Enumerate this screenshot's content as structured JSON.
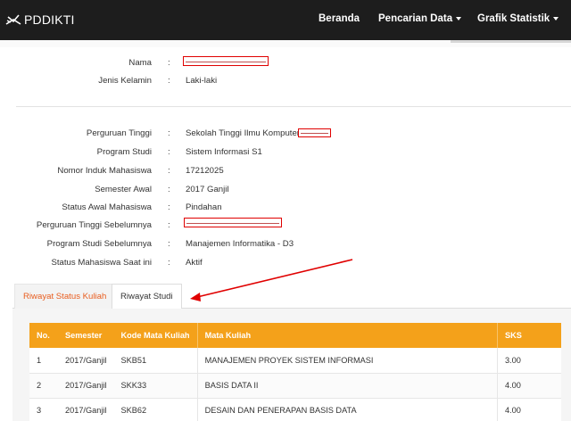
{
  "navbar": {
    "brand": "PDDIKTI",
    "items": [
      {
        "label": "Beranda",
        "dropdown": false
      },
      {
        "label": "Pencarian Data",
        "dropdown": true
      },
      {
        "label": "Grafik Statistik",
        "dropdown": true
      }
    ]
  },
  "profile": {
    "personal": [
      {
        "label": "Nama",
        "value": "",
        "redacted": true
      },
      {
        "label": "Jenis Kelamin",
        "value": "Laki-laki"
      }
    ],
    "academic": [
      {
        "label": "Perguruan Tinggi",
        "value": "Sekolah Tinggi Ilmu Komputer",
        "partially_redacted": true
      },
      {
        "label": "Program Studi",
        "value": "Sistem Informasi S1"
      },
      {
        "label": "Nomor Induk Mahasiswa",
        "value": "17212025"
      },
      {
        "label": "Semester Awal",
        "value": "2017 Ganjil"
      },
      {
        "label": "Status Awal Mahasiswa",
        "value": "Pindahan"
      },
      {
        "label": "Perguruan Tinggi Sebelumnya",
        "value": "",
        "redacted": true
      },
      {
        "label": "Program Studi Sebelumnya",
        "value": "Manajemen Informatika - D3"
      },
      {
        "label": "Status Mahasiswa Saat ini",
        "value": "Aktif"
      }
    ]
  },
  "tabs": [
    {
      "label": "Riwayat Status Kuliah",
      "active": false
    },
    {
      "label": "Riwayat Studi",
      "active": true
    }
  ],
  "table": {
    "headers": [
      "No.",
      "Semester",
      "Kode Mata Kuliah",
      "Mata Kuliah",
      "SKS"
    ],
    "rows": [
      [
        "1",
        "2017/Ganjil",
        "SKB51",
        "MANAJEMEN PROYEK SISTEM INFORMASI",
        "3.00"
      ],
      [
        "2",
        "2017/Ganjil",
        "SKK33",
        "BASIS DATA II",
        "4.00"
      ],
      [
        "3",
        "2017/Ganjil",
        "SKB62",
        "DESAIN DAN PENERAPAN BASIS DATA",
        "4.00"
      ]
    ]
  },
  "colors": {
    "navbar": "#1d1d1d",
    "table_header": "#f4a11a",
    "active_tab_text": "#e85d1f",
    "annotation": "#e00000"
  }
}
